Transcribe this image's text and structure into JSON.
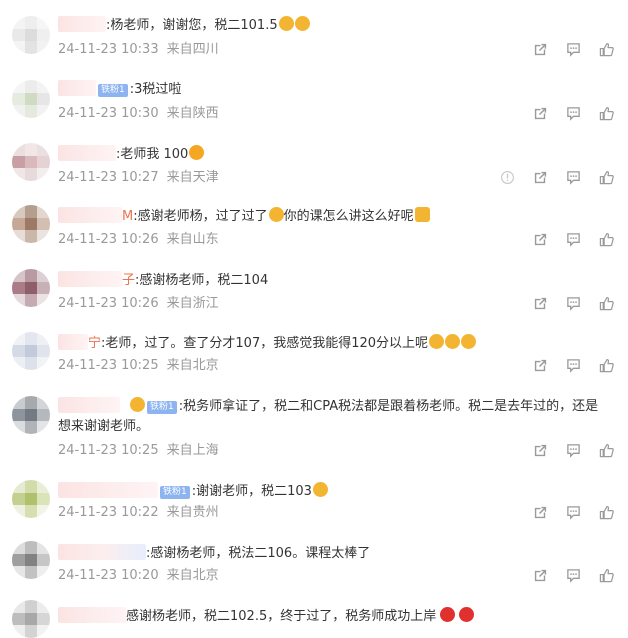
{
  "comments": [
    {
      "name_tail": "",
      "text": ":杨老师，谢谢您，税二101.5",
      "emojis": [
        "#f3b432",
        "#f3b432"
      ],
      "date": "24-11-23 10:33",
      "location": "来自四川",
      "report": false,
      "badge": ""
    },
    {
      "name_tail": "",
      "text": ":3税过啦",
      "emojis": [],
      "date": "24-11-23 10:30",
      "location": "来自陕西",
      "report": false,
      "badge": "铁粉1"
    },
    {
      "name_tail": "",
      "text": ":老师我 100",
      "emojis": [
        "#f5a623"
      ],
      "date": "24-11-23 10:27",
      "location": "来自天津",
      "report": true,
      "badge": ""
    },
    {
      "name_tail": "M",
      "text": ":感谢老师杨，过了过了",
      "emojis": [
        "#f3b432"
      ],
      "text2": "你的课怎么讲这么好呢",
      "emojis2": [
        "#f3b432"
      ],
      "date": "24-11-23 10:26",
      "location": "来自山东",
      "report": false,
      "badge": ""
    },
    {
      "name_tail": "子",
      "text": ":感谢杨老师，税二104",
      "emojis": [],
      "date": "24-11-23 10:26",
      "location": "来自浙江",
      "report": false,
      "badge": ""
    },
    {
      "name_tail": "宁",
      "text": ":老师，过了。查了分才107，我感觉我能得120分以上呢",
      "emojis": [
        "#f3b432",
        "#f3b432",
        "#f3b432"
      ],
      "date": "24-11-23 10:25",
      "location": "来自北京",
      "report": false,
      "badge": ""
    },
    {
      "name_tail": "",
      "text": ":税务师拿证了，税二和CPA税法都是跟着杨老师。税二是去年过的，还是想来谢谢老师。",
      "emojis": [],
      "date": "24-11-23 10:25",
      "location": "来自上海",
      "report": false,
      "badge": "铁粉1"
    },
    {
      "name_tail": "",
      "text": ":谢谢老师，税二103",
      "emojis": [
        "#f3b432"
      ],
      "date": "24-11-23 10:22",
      "location": "来自贵州",
      "report": false,
      "badge": "铁粉1"
    },
    {
      "name_tail": "",
      "text": ":感谢杨老师，税法二106。课程太棒了",
      "emojis": [],
      "date": "24-11-23 10:20",
      "location": "来自北京",
      "report": false,
      "badge": ""
    },
    {
      "name_tail": "",
      "text": "感谢杨老师，税二102.5，终于过了，税务师成功上岸",
      "emojis": [
        "#e0312f",
        "#e0312f"
      ],
      "date": "",
      "location": "",
      "report": false,
      "badge": ""
    }
  ]
}
